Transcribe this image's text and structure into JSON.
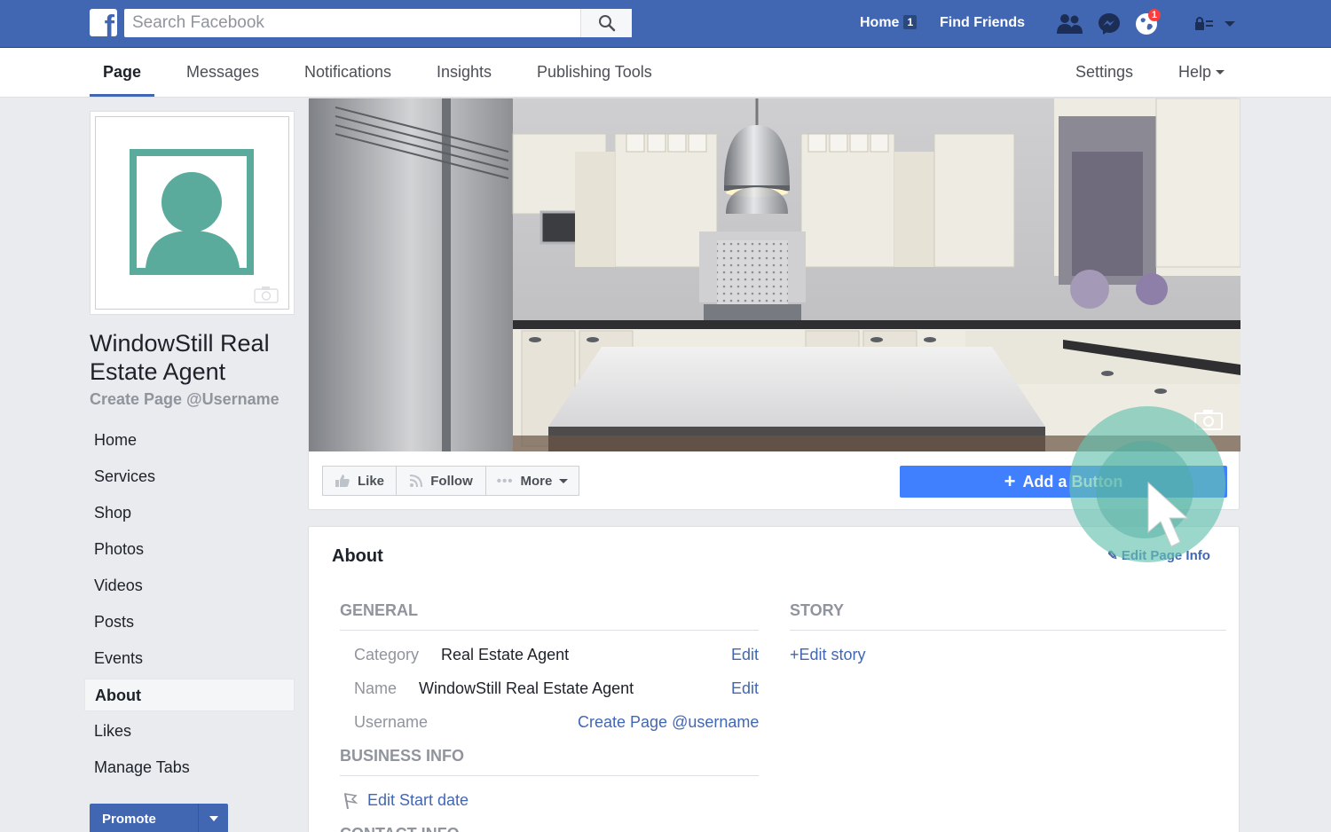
{
  "topbar": {
    "logo": "f",
    "search_placeholder": "Search Facebook",
    "home_label": "Home",
    "home_badge": "1",
    "find_friends_label": "Find Friends",
    "notifications_count": "1"
  },
  "tabs": {
    "page": "Page",
    "messages": "Messages",
    "notifications": "Notifications",
    "insights": "Insights",
    "publishing_tools": "Publishing Tools",
    "settings": "Settings",
    "help": "Help"
  },
  "sidebar": {
    "page_name": "WindowStill Real Estate Agent",
    "username_link": "Create Page @Username",
    "items": [
      {
        "label": "Home"
      },
      {
        "label": "Services"
      },
      {
        "label": "Shop"
      },
      {
        "label": "Photos"
      },
      {
        "label": "Videos"
      },
      {
        "label": "Posts"
      },
      {
        "label": "Events"
      },
      {
        "label": "About"
      },
      {
        "label": "Likes"
      },
      {
        "label": "Manage Tabs"
      }
    ],
    "promote_label": "Promote"
  },
  "actions": {
    "like": "Like",
    "follow": "Follow",
    "more": "More",
    "add_button": "Add a Button"
  },
  "about": {
    "title": "About",
    "edit_page_info": "Edit Page Info",
    "general_heading": "GENERAL",
    "story_heading": "STORY",
    "category_label": "Category",
    "category_value": "Real Estate Agent",
    "name_label": "Name",
    "name_value": "WindowStill Real Estate Agent",
    "username_label": "Username",
    "username_link": "Create Page @username",
    "edit_label": "Edit",
    "edit_story": "+Edit story",
    "business_info_heading": "BUSINESS INFO",
    "edit_start_date": "Edit Start date",
    "contact_info_heading": "CONTACT INFO"
  },
  "colors": {
    "brand_blue": "#4267b2",
    "cta_blue": "#4080ff",
    "avatar_teal": "#5aab9b",
    "highlight": "#66c2af"
  }
}
